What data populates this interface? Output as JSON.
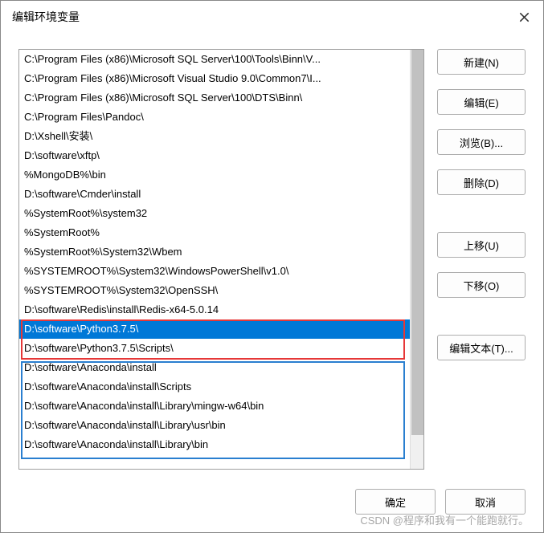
{
  "dialog": {
    "title": "编辑环境变量"
  },
  "list": {
    "items": [
      {
        "value": "C:\\Program Files (x86)\\Microsoft SQL Server\\100\\Tools\\Binn\\V...",
        "selected": false
      },
      {
        "value": "C:\\Program Files (x86)\\Microsoft Visual Studio 9.0\\Common7\\I...",
        "selected": false
      },
      {
        "value": "C:\\Program Files (x86)\\Microsoft SQL Server\\100\\DTS\\Binn\\",
        "selected": false
      },
      {
        "value": "C:\\Program Files\\Pandoc\\",
        "selected": false
      },
      {
        "value": "D:\\Xshell\\安装\\",
        "selected": false
      },
      {
        "value": "D:\\software\\xftp\\",
        "selected": false
      },
      {
        "value": "%MongoDB%\\bin",
        "selected": false
      },
      {
        "value": "D:\\software\\Cmder\\install",
        "selected": false
      },
      {
        "value": "%SystemRoot%\\system32",
        "selected": false
      },
      {
        "value": "%SystemRoot%",
        "selected": false
      },
      {
        "value": "%SystemRoot%\\System32\\Wbem",
        "selected": false
      },
      {
        "value": "%SYSTEMROOT%\\System32\\WindowsPowerShell\\v1.0\\",
        "selected": false
      },
      {
        "value": "%SYSTEMROOT%\\System32\\OpenSSH\\",
        "selected": false
      },
      {
        "value": "D:\\software\\Redis\\install\\Redis-x64-5.0.14",
        "selected": false
      },
      {
        "value": "D:\\software\\Python3.7.5\\",
        "selected": true
      },
      {
        "value": "D:\\software\\Python3.7.5\\Scripts\\",
        "selected": false
      },
      {
        "value": "D:\\software\\Anaconda\\install",
        "selected": false
      },
      {
        "value": "D:\\software\\Anaconda\\install\\Scripts",
        "selected": false
      },
      {
        "value": "D:\\software\\Anaconda\\install\\Library\\mingw-w64\\bin",
        "selected": false
      },
      {
        "value": "D:\\software\\Anaconda\\install\\Library\\usr\\bin",
        "selected": false
      },
      {
        "value": "D:\\software\\Anaconda\\install\\Library\\bin",
        "selected": false
      }
    ]
  },
  "buttons": {
    "new": "新建(N)",
    "edit": "编辑(E)",
    "browse": "浏览(B)...",
    "delete": "删除(D)",
    "moveUp": "上移(U)",
    "moveDown": "下移(O)",
    "editText": "编辑文本(T)...",
    "ok": "确定",
    "cancel": "取消"
  },
  "watermark": "CSDN @程序和我有一个能跑就行。"
}
